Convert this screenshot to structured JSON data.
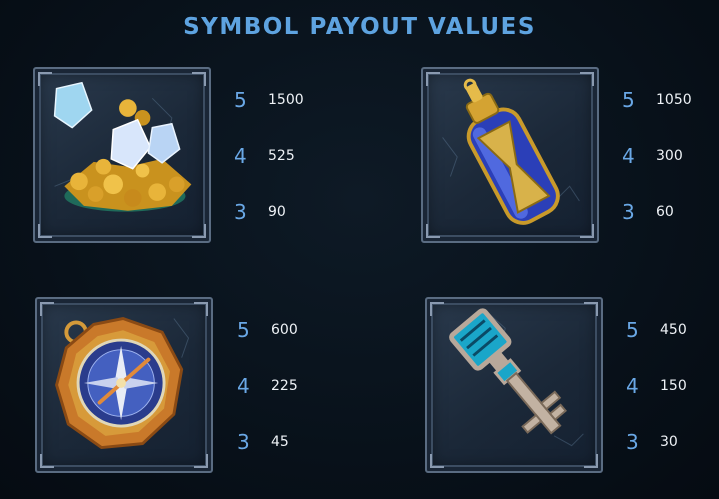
{
  "title": "SYMBOL PAYOUT VALUES",
  "symbols": [
    {
      "icon": "gold-crystals-icon",
      "payouts": [
        {
          "count": "5",
          "value": "1500"
        },
        {
          "count": "4",
          "value": "525"
        },
        {
          "count": "3",
          "value": "90"
        }
      ]
    },
    {
      "icon": "hourglass-bottle-icon",
      "payouts": [
        {
          "count": "5",
          "value": "1050"
        },
        {
          "count": "4",
          "value": "300"
        },
        {
          "count": "3",
          "value": "60"
        }
      ]
    },
    {
      "icon": "compass-icon",
      "payouts": [
        {
          "count": "5",
          "value": "600"
        },
        {
          "count": "4",
          "value": "225"
        },
        {
          "count": "3",
          "value": "45"
        }
      ]
    },
    {
      "icon": "key-icon",
      "payouts": [
        {
          "count": "5",
          "value": "450"
        },
        {
          "count": "4",
          "value": "150"
        },
        {
          "count": "3",
          "value": "30"
        }
      ]
    }
  ],
  "colors": {
    "title": "#5ea3e0",
    "count": "#6aa8e6",
    "value": "#eef2f6",
    "background": "#08111a"
  }
}
